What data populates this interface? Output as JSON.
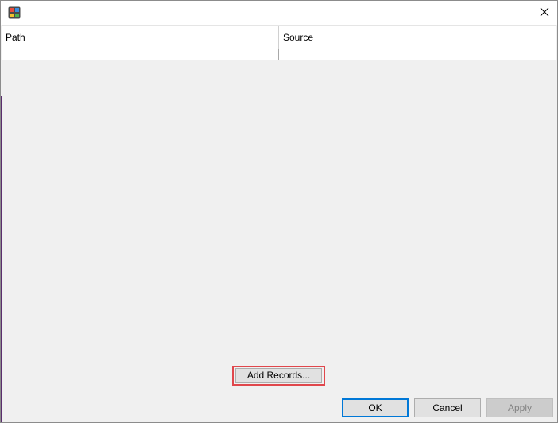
{
  "window": {
    "title": "",
    "close_glyph": "✕"
  },
  "table": {
    "columns": [
      "Path",
      "Source"
    ],
    "rows": [
      [
        "",
        ""
      ]
    ]
  },
  "buttons": {
    "add_records": "Add Records...",
    "ok": "OK",
    "cancel": "Cancel",
    "apply": "Apply"
  },
  "colors": {
    "highlight": "#e0474c",
    "focus": "#0078d7",
    "disabled_text": "#838383"
  },
  "icons": {
    "app": "app-icon",
    "close": "close-icon"
  }
}
